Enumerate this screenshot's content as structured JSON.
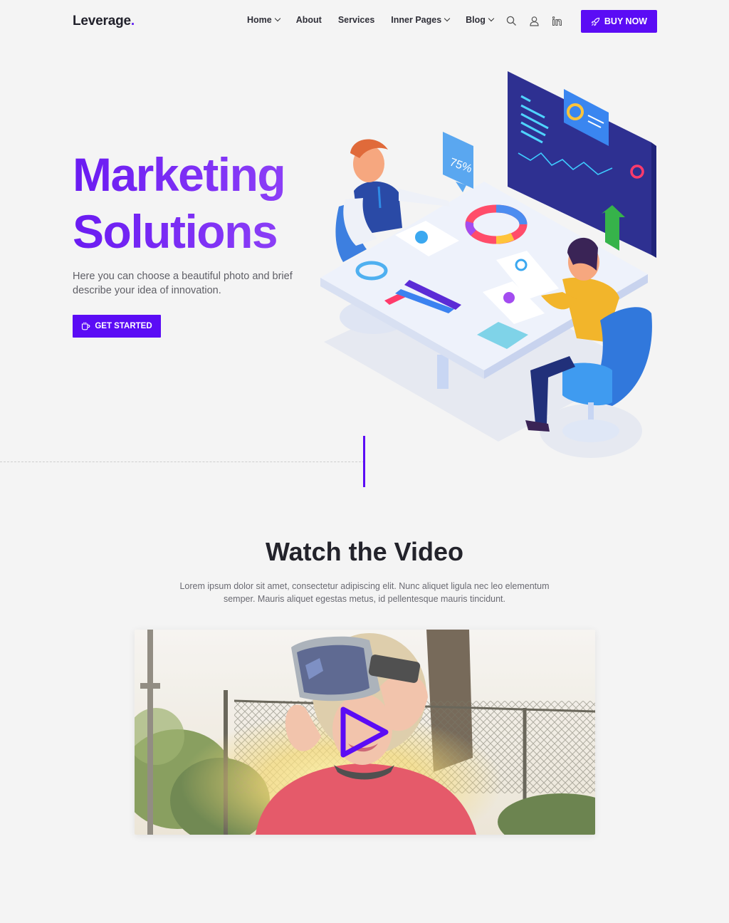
{
  "header": {
    "logo": "Leverage",
    "logo_dot": ".",
    "nav": {
      "home": "Home",
      "about": "About",
      "services": "Services",
      "inner_pages": "Inner Pages",
      "blog": "Blog"
    },
    "icons": [
      "search-icon",
      "user-icon",
      "linkedin-icon"
    ],
    "buy_label": "BUY NOW"
  },
  "hero": {
    "title_line1": "Marketing",
    "title_line2": "Solutions",
    "description": "Here you can choose a beautiful photo and brief describe your idea of innovation.",
    "cta_label": "GET STARTED",
    "badge_value": "75%"
  },
  "video_section": {
    "title": "Watch the Video",
    "description": "Lorem ipsum dolor sit amet, consectetur adipiscing elit. Nunc aliquet ligula nec leo elementum semper. Mauris aliquet egestas metus, id pellentesque mauris tincidunt."
  },
  "colors": {
    "accent": "#5b0cf5",
    "background": "#f4f4f4",
    "heading": "#23232b"
  }
}
